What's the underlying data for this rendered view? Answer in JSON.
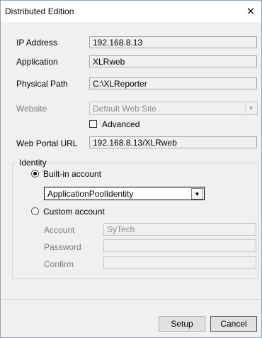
{
  "window": {
    "title": "Distributed Edition",
    "close_glyph": "✕"
  },
  "form": {
    "ip_label": "IP Address",
    "ip_value": "192.168.8.13",
    "app_label": "Application",
    "app_value": "XLRweb",
    "path_label": "Physical Path",
    "path_value": "C:\\XLReporter",
    "website_label": "Website",
    "website_value": "Default Web Site",
    "advanced_label": "Advanced",
    "url_label": "Web Portal URL",
    "url_value": "192.168.8.13/XLRweb"
  },
  "identity": {
    "title": "Identity",
    "builtin_label": "Built-in account",
    "builtin_value": "ApplicationPoolIdentity",
    "custom_label": "Custom account",
    "account_label": "Account",
    "account_value": "SyTech",
    "password_label": "Password",
    "password_value": "",
    "confirm_label": "Confirm",
    "confirm_value": ""
  },
  "buttons": {
    "setup": "Setup",
    "cancel": "Cancel"
  },
  "icons": {
    "dropdown": "chevron-down-icon",
    "close": "close-icon"
  }
}
